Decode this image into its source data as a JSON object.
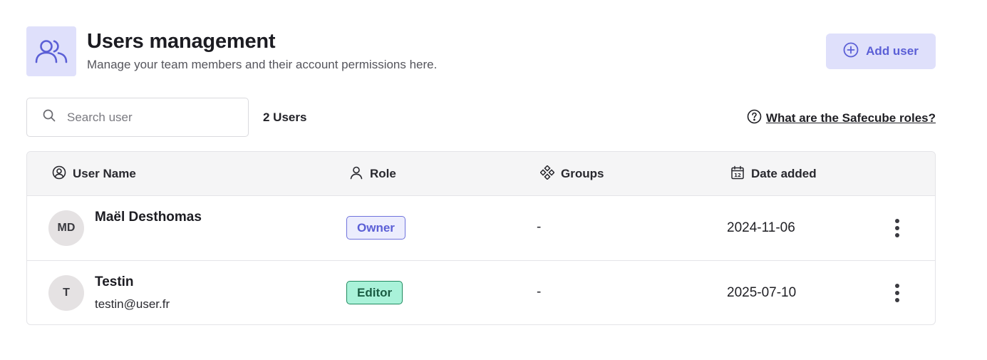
{
  "header": {
    "icon": "users-icon",
    "title": "Users management",
    "subtitle": "Manage your team members and their account permissions here.",
    "add_user_label": "Add user"
  },
  "toolbar": {
    "search_placeholder": "Search user",
    "search_value": "",
    "user_count": "2 Users",
    "roles_link": "What are the Safecube roles?"
  },
  "table": {
    "columns": {
      "user_name": "User Name",
      "role": "Role",
      "groups": "Groups",
      "date_added": "Date added"
    },
    "rows": [
      {
        "initials": "MD",
        "name": "Maël Desthomas",
        "email": "",
        "role": "Owner",
        "groups": "-",
        "date_added": "2024-11-06"
      },
      {
        "initials": "T",
        "name": "Testin",
        "email": "testin@user.fr",
        "role": "Editor",
        "groups": "-",
        "date_added": "2025-07-10"
      }
    ]
  },
  "colors": {
    "accent": "#5b5fd6",
    "accent_bg": "#dfe0fb",
    "editor_bg": "#a9f2d9",
    "editor_border": "#1f8a5f"
  }
}
